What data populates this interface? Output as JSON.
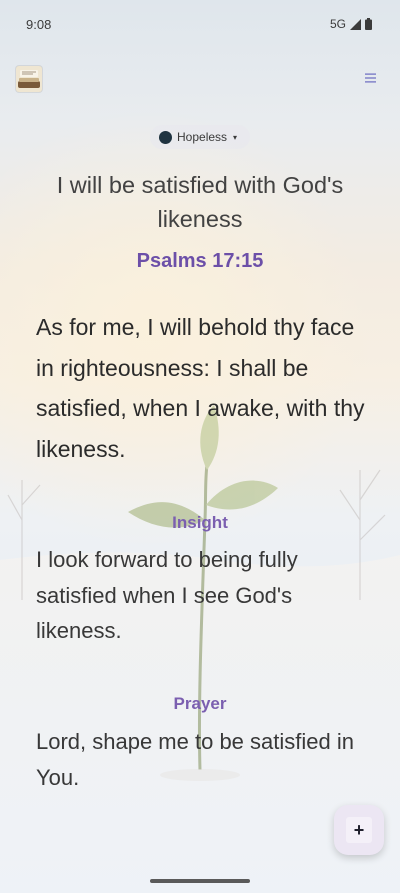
{
  "status_bar": {
    "time": "9:08",
    "network": "5G"
  },
  "mood": {
    "label": "Hopeless",
    "caret": "▾",
    "dot_color": "#1f3340"
  },
  "verse": {
    "title": "I will be satisfied with God's likeness",
    "reference": "Psalms 17:15",
    "text": "As for me, I will behold thy face in righteousness: I shall be satisfied, when I awake, with thy likeness."
  },
  "insight": {
    "label": "Insight",
    "text": "I look forward to being fully satisfied when I see God's likeness."
  },
  "prayer": {
    "label": "Prayer",
    "text": "Lord, shape me to be satisfied in You."
  },
  "fab": {
    "symbol": "+"
  },
  "colors": {
    "accent": "#6c4fa8",
    "label": "#7b5fb0",
    "text": "#2b2b2b"
  }
}
